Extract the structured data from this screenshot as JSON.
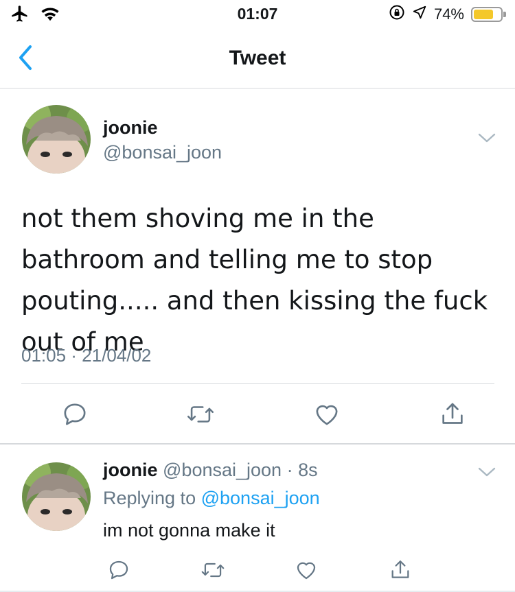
{
  "status_bar": {
    "time": "01:07",
    "battery_percent": "74%",
    "battery_level": 0.74,
    "icons": [
      "airplane-icon",
      "wifi-icon",
      "orientation-lock-icon",
      "location-icon",
      "battery-icon"
    ]
  },
  "nav": {
    "title": "Tweet",
    "back_icon": "chevron-left-icon"
  },
  "tweet": {
    "author_name": "joonie",
    "author_handle": "@bonsai_joon",
    "text": "not them shoving me in the bathroom and telling me to stop pouting..... and then kissing the fuck out of me",
    "meta": "01:05 · 21/04/02",
    "actions": [
      "reply-icon",
      "retweet-icon",
      "like-icon",
      "share-icon"
    ]
  },
  "reply": {
    "author_name": "joonie",
    "author_handle": "@bonsai_joon",
    "time_separator": "·",
    "time": "8s",
    "replying_to_prefix": "Replying to",
    "replying_to_handle": "@bonsai_joon",
    "text": "im not gonna make it",
    "actions": [
      "reply-icon",
      "retweet-icon",
      "like-icon",
      "share-icon"
    ]
  },
  "colors": {
    "accent": "#1da1f2",
    "secondary_text": "#657786",
    "divider": "#d6d9dc",
    "battery": "#f4c82b"
  }
}
